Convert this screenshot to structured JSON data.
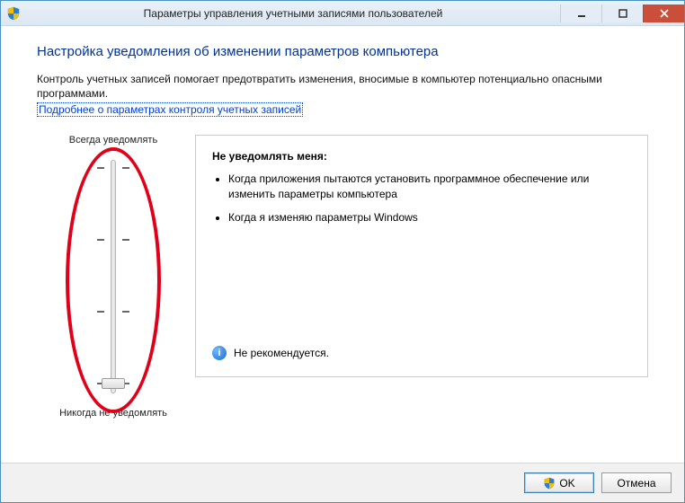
{
  "window": {
    "title": "Параметры управления учетными записями пользователей"
  },
  "heading": "Настройка уведомления об изменении параметров компьютера",
  "intro": "Контроль учетных записей помогает предотвратить изменения, вносимые в компьютер потенциально опасными программами.",
  "link_label": "Подробнее о параметрах контроля учетных записей",
  "slider": {
    "top_label": "Всегда уведомлять",
    "bottom_label": "Никогда не уведомлять",
    "levels": 4,
    "current_level": 0
  },
  "description": {
    "title": "Не уведомлять меня:",
    "bullets": [
      "Когда приложения пытаются установить программное обеспечение или изменить параметры компьютера",
      "Когда я изменяю параметры Windows"
    ],
    "recommendation": "Не рекомендуется."
  },
  "buttons": {
    "ok": "OK",
    "cancel": "Отмена"
  }
}
